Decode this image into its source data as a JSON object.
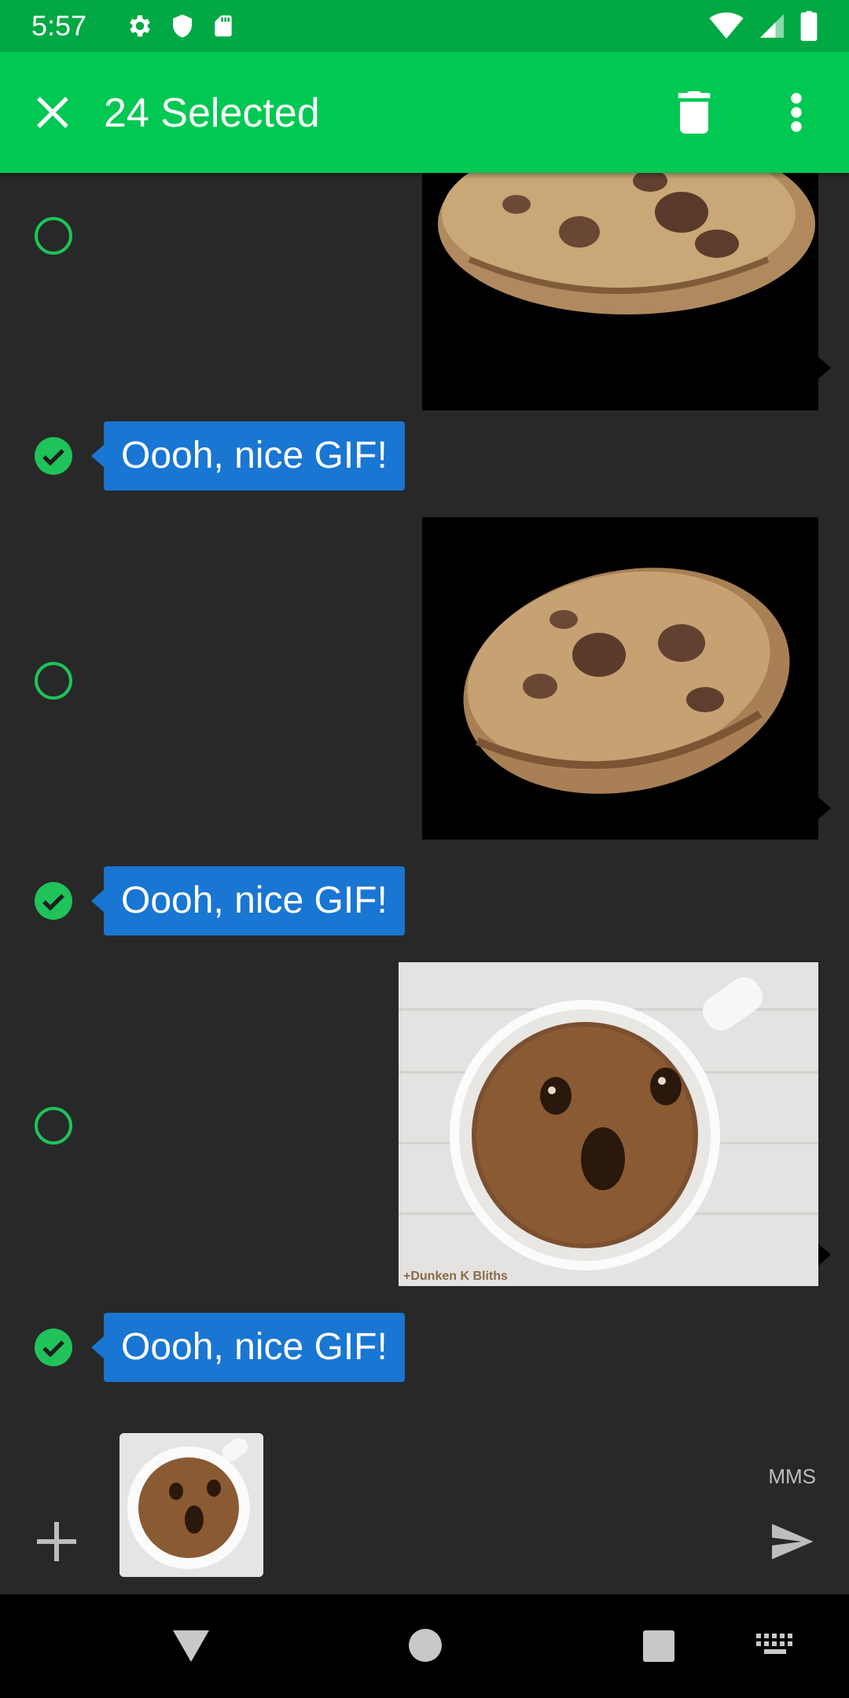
{
  "status_bar": {
    "time": "5:57",
    "icons_left": [
      "settings-icon",
      "shield-icon",
      "sd-card-icon"
    ],
    "icons_right": [
      "wifi-icon",
      "signal-icon",
      "battery-icon"
    ]
  },
  "action_bar": {
    "title": "24 Selected",
    "close_icon": "close-icon",
    "delete_icon": "delete-icon",
    "overflow_icon": "more-vert-icon"
  },
  "messages": [
    {
      "type": "gif",
      "direction": "outgoing",
      "selected": false,
      "content": "cookie"
    },
    {
      "type": "text",
      "direction": "incoming",
      "selected": true,
      "text": "Oooh, nice GIF!"
    },
    {
      "type": "gif",
      "direction": "outgoing",
      "selected": false,
      "content": "cookie"
    },
    {
      "type": "text",
      "direction": "incoming",
      "selected": true,
      "text": "Oooh, nice GIF!"
    },
    {
      "type": "gif",
      "direction": "outgoing",
      "selected": false,
      "content": "coffee",
      "watermark": "+Dunken K Bliths"
    },
    {
      "type": "text",
      "direction": "incoming",
      "selected": true,
      "text": "Oooh, nice GIF!"
    }
  ],
  "compose": {
    "mode_label": "MMS",
    "attachment": "coffee-gif-thumbnail",
    "add_icon": "add-icon",
    "send_icon": "send-icon"
  },
  "nav_bar": {
    "icons": [
      "back-icon",
      "home-icon",
      "recents-icon",
      "keyboard-icon"
    ]
  },
  "colors": {
    "status_bar": "#00a844",
    "action_bar": "#00c853",
    "background": "#282828",
    "incoming_bubble": "#1976d2",
    "select_accent": "#1fc35a"
  }
}
